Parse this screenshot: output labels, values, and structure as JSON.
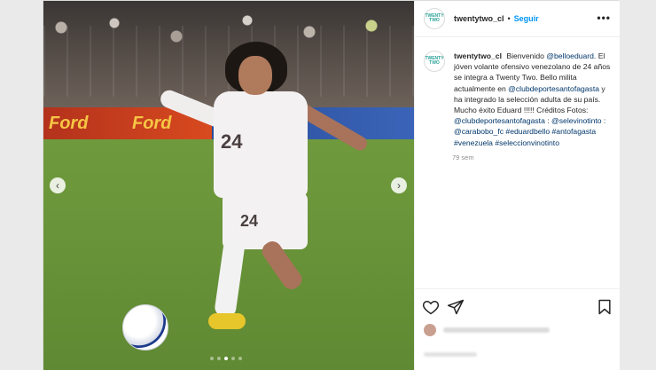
{
  "post": {
    "username": "twentytwo_cl",
    "avatar_text": "TWENTY TWO",
    "separator": "•",
    "follow_label": "Seguir",
    "more_icon": "•••",
    "media": {
      "shirt_number": "24",
      "shorts_number": "24",
      "ad_left": "Ford",
      "ad_left_2": "Ford",
      "carousel_dots": 5,
      "active_dot": 2
    },
    "caption": {
      "username": "twentytwo_cl",
      "line1": "Bienvenido",
      "mention1": "@belloeduard",
      "line2": ". El jóven volante ofensivo venezolano de 24 años se integra a Twenty Two. Bello milita actualmente en",
      "mention2": "@clubdeportesantofagasta",
      "line3": "y ha integrado la selección adulta de su país. Mucho éxito Eduard !!!!! Créditos Fotos:",
      "mention3": "@clubdeportesantofagasta",
      "line4": ":",
      "mention4": "@selevinotinto",
      "line5": ":",
      "mention5": "@carabobo_fc",
      "hashtags": [
        "#eduardbello",
        "#antofagasta",
        "#venezuela",
        "#seleccionvinotinto"
      ],
      "time": "79 sem"
    }
  },
  "colors": {
    "accent": "#0095f6",
    "link": "#00376b",
    "muted": "#8e8e8e"
  }
}
